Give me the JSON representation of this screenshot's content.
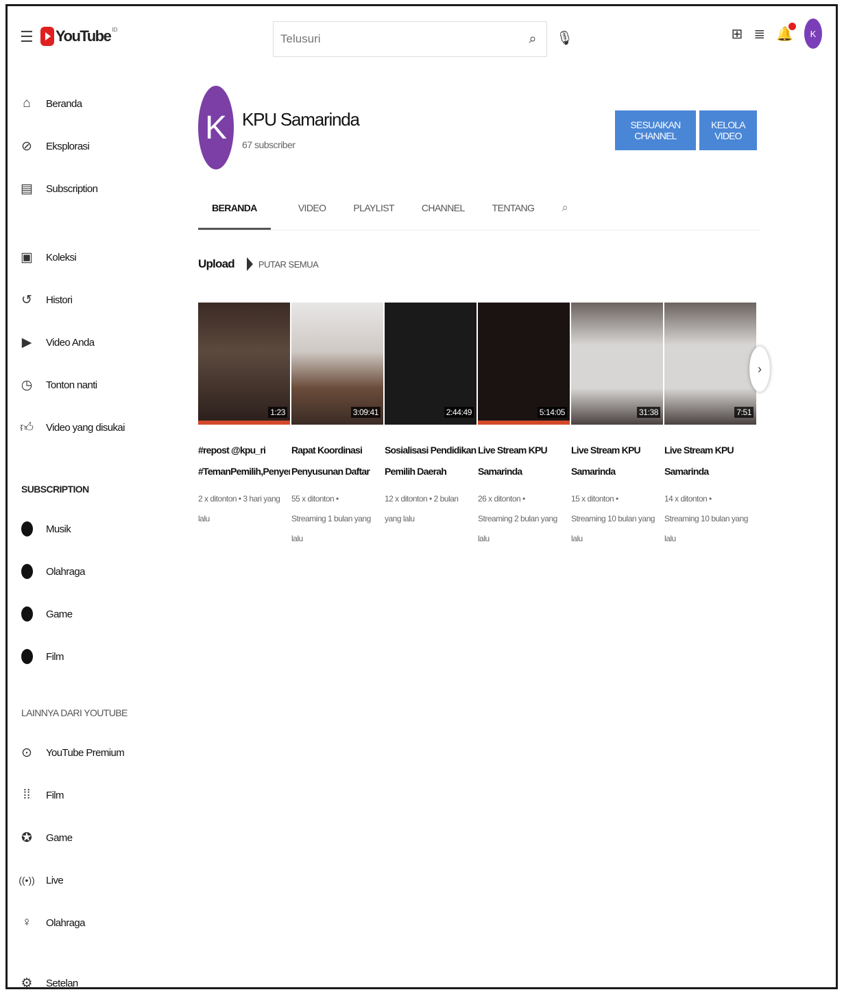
{
  "topbar": {
    "logo_text": "YouTube",
    "logo_sup": "ID",
    "search_placeholder": "Telusuri",
    "avatar_initial": "K"
  },
  "sidebar": {
    "main_items": [
      {
        "label": "Beranda",
        "icon": "home-icon"
      },
      {
        "label": "Eksplorasi",
        "icon": "compass-icon"
      },
      {
        "label": "Subscription",
        "icon": "subscriptions-icon"
      }
    ],
    "library_items": [
      {
        "label": "Koleksi",
        "icon": "library-icon"
      },
      {
        "label": "Histori",
        "icon": "history-icon"
      },
      {
        "label": "Video Anda",
        "icon": "your-videos-icon"
      },
      {
        "label": "Tonton nanti",
        "icon": "watch-later-icon"
      },
      {
        "label": "Video yang disukai",
        "icon": "thumbs-up-icon"
      }
    ],
    "subscription_title": "SUBSCRIPTION",
    "subscriptions": [
      {
        "label": "Musik"
      },
      {
        "label": "Olahraga"
      },
      {
        "label": "Game"
      },
      {
        "label": "Film"
      }
    ],
    "more_title": "LAINNYA DARI YOUTUBE",
    "more_items": [
      {
        "label": "YouTube Premium",
        "icon": "premium-icon"
      },
      {
        "label": "Film",
        "icon": "film-icon"
      },
      {
        "label": "Game",
        "icon": "gaming-icon"
      },
      {
        "label": "Live",
        "icon": "live-icon"
      },
      {
        "label": "Olahraga",
        "icon": "trophy-icon"
      }
    ],
    "settings_label": "Setelan"
  },
  "channel": {
    "avatar_initial": "K",
    "name": "KPU Samarinda",
    "subscribers": "67 subscriber",
    "customize_label": "SESUAIKAN CHANNEL",
    "manage_label": "KELOLA VIDEO"
  },
  "tabs": [
    "BERANDA",
    "VIDEO",
    "PLAYLIST",
    "CHANNEL",
    "TENTANG"
  ],
  "uploads": {
    "title": "Upload",
    "play_all": "PUTAR SEMUA",
    "videos": [
      {
        "title": "#repost @kpu_ri\n#TemanPemilih,Penyeraha...",
        "meta": "2 x ditonton • 3 hari yang lalu",
        "duration": "1:23"
      },
      {
        "title": "Rapat Koordinasi\nPenyusunan Daftar Pemilih...",
        "meta": "55 x ditonton •\nStreaming 1 bulan yang lalu",
        "duration": "3:09:41"
      },
      {
        "title": "Sosialisasi Pendidikan\nPemilih Daerah Partisipasi...",
        "meta": "12 x ditonton • 2 bulan yang lalu",
        "duration": "2:44:49"
      },
      {
        "title": "Live Stream KPU Samarinda\n- Sosialisasi Pendidikan...",
        "meta": "26 x ditonton •\nStreaming 2 bulan yang lalu",
        "duration": "5:14:05"
      },
      {
        "title": "Live Stream KPU Samarinda\n- Rekapitulasi di Kecamat...",
        "meta": "15 x ditonton •\nStreaming 10 bulan yang lalu",
        "duration": "31:38"
      },
      {
        "title": "Live Stream KPU Samarinda\n- Rapat Pleno di Kecamata...",
        "meta": "14 x ditonton •\nStreaming 10 bulan yang lalu",
        "duration": "7:51"
      }
    ]
  },
  "colors": {
    "accent_blue": "#4a86d6",
    "avatar_purple": "#7b3fa6",
    "youtube_red": "#e02020"
  }
}
